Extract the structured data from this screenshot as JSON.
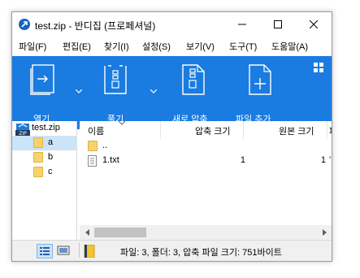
{
  "window": {
    "title": "test.zip - 반디집 (프로페셔널)"
  },
  "menu": [
    {
      "label": "파일(F)"
    },
    {
      "label": "편집(E)"
    },
    {
      "label": "찾기(I)"
    },
    {
      "label": "설정(S)"
    },
    {
      "label": "보기(V)"
    },
    {
      "label": "도구(T)"
    },
    {
      "label": "도움말(A)"
    }
  ],
  "ribbon": {
    "buttons": [
      {
        "label": "열기",
        "icon": "open-archive-icon",
        "has_dropdown": true
      },
      {
        "label": "풀기",
        "icon": "extract-icon",
        "has_dropdown": true
      },
      {
        "label": "새로 압축",
        "icon": "new-archive-icon",
        "has_dropdown": false
      },
      {
        "label": "파일 추가",
        "icon": "add-file-icon",
        "has_dropdown": false
      }
    ],
    "background": "#1a7be0"
  },
  "tree": {
    "root": "test.zip",
    "children": [
      {
        "label": "a",
        "selected": true
      },
      {
        "label": "b",
        "selected": false
      },
      {
        "label": "c",
        "selected": false
      }
    ]
  },
  "list": {
    "columns": [
      "이름",
      "압축 크기",
      "원본 크기",
      "파"
    ],
    "rows": [
      {
        "name": "..",
        "type": "folder",
        "packed": "",
        "original": "",
        "extra": ""
      },
      {
        "name": "1.txt",
        "type": "file",
        "packed": "1",
        "original": "1",
        "extra": "'"
      }
    ]
  },
  "status": {
    "text": "파일: 3, 폴더: 3, 압축 파일 크기: 751바이트"
  }
}
